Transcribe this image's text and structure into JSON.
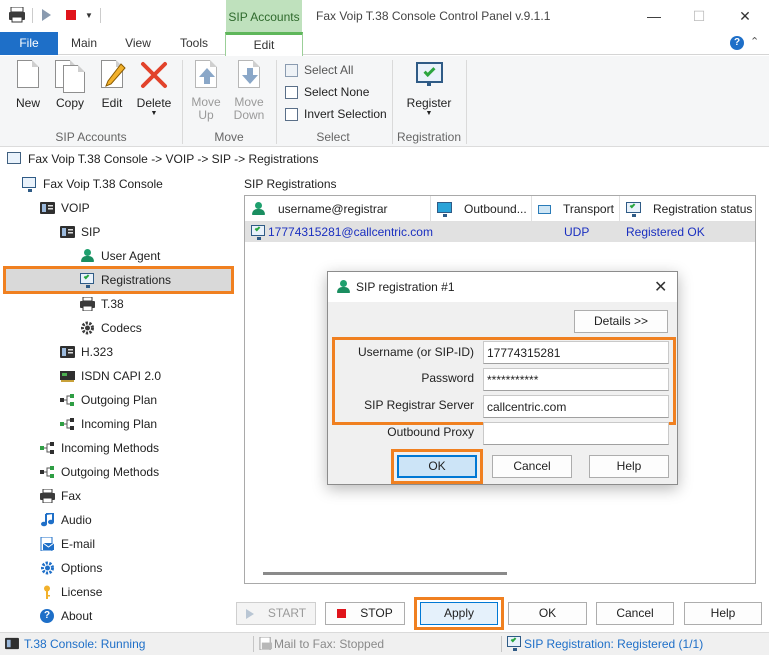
{
  "titlebar": {
    "context_tab": "SIP Accounts",
    "window_title": "Fax Voip T.38 Console Control Panel v.9.1.1",
    "minimize": "—",
    "maximize": "☐",
    "close": "✕"
  },
  "ribbon": {
    "tabs": [
      "File",
      "Main",
      "View",
      "Tools",
      "Edit"
    ],
    "help": "?",
    "collapse": "⌃",
    "groups": {
      "sip_accounts": {
        "label": "SIP Accounts",
        "buttons": {
          "new": "New",
          "copy": "Copy",
          "edit": "Edit",
          "delete": "Delete"
        }
      },
      "move": {
        "label": "Move",
        "buttons": {
          "move_up": "Move Up",
          "move_down": "Move Down"
        }
      },
      "select": {
        "label": "Select",
        "items": {
          "select_all": "Select All",
          "select_none": "Select None",
          "invert_selection": "Invert Selection"
        }
      },
      "registration": {
        "label": "Registration",
        "buttons": {
          "register": "Register"
        }
      }
    }
  },
  "breadcrumb": "Fax Voip T.38 Console -> VOIP -> SIP -> Registrations",
  "tree": {
    "root": "Fax Voip T.38 Console",
    "voip": "VOIP",
    "sip": "SIP",
    "user_agent": "User Agent",
    "registrations": "Registrations",
    "t38": "T.38",
    "codecs": "Codecs",
    "h323": "H.323",
    "isdn": "ISDN CAPI 2.0",
    "outgoing_plan": "Outgoing Plan",
    "incoming_plan": "Incoming Plan",
    "incoming_methods": "Incoming Methods",
    "outgoing_methods": "Outgoing Methods",
    "fax": "Fax",
    "audio": "Audio",
    "email": "E-mail",
    "options": "Options",
    "license": "License",
    "about": "About"
  },
  "panel": {
    "title": "SIP Registrations",
    "columns": [
      "username@registrar",
      "Outbound...",
      "Transport",
      "Registration status"
    ],
    "rows": [
      {
        "username": "17774315281@callcentric.com",
        "outbound": "",
        "transport": "UDP",
        "status": "Registered OK"
      }
    ]
  },
  "bottom_buttons": {
    "start": "START",
    "stop": "STOP",
    "apply": "Apply",
    "ok": "OK",
    "cancel": "Cancel",
    "help": "Help"
  },
  "statusbar": {
    "console": "T.38 Console: Running",
    "mail": "Mail to Fax: Stopped",
    "sip": "SIP Registration: Registered (1/1)"
  },
  "dialog": {
    "title": "SIP registration #1",
    "close": "✕",
    "details": "Details >>",
    "fields": {
      "username_label": "Username (or SIP-ID)",
      "username_value": "17774315281",
      "password_label": "Password",
      "password_value": "***********",
      "registrar_label": "SIP Registrar Server",
      "registrar_value": "callcentric.com",
      "proxy_label": "Outbound Proxy",
      "proxy_value": ""
    },
    "buttons": {
      "ok": "OK",
      "cancel": "Cancel",
      "help": "Help"
    }
  },
  "colors": {
    "accent_blue": "#1e6fc8",
    "context_green": "#5fb75b",
    "highlight_orange": "#f08020",
    "link_blue": "#1a2fc0",
    "stop_red": "#e0141b"
  }
}
